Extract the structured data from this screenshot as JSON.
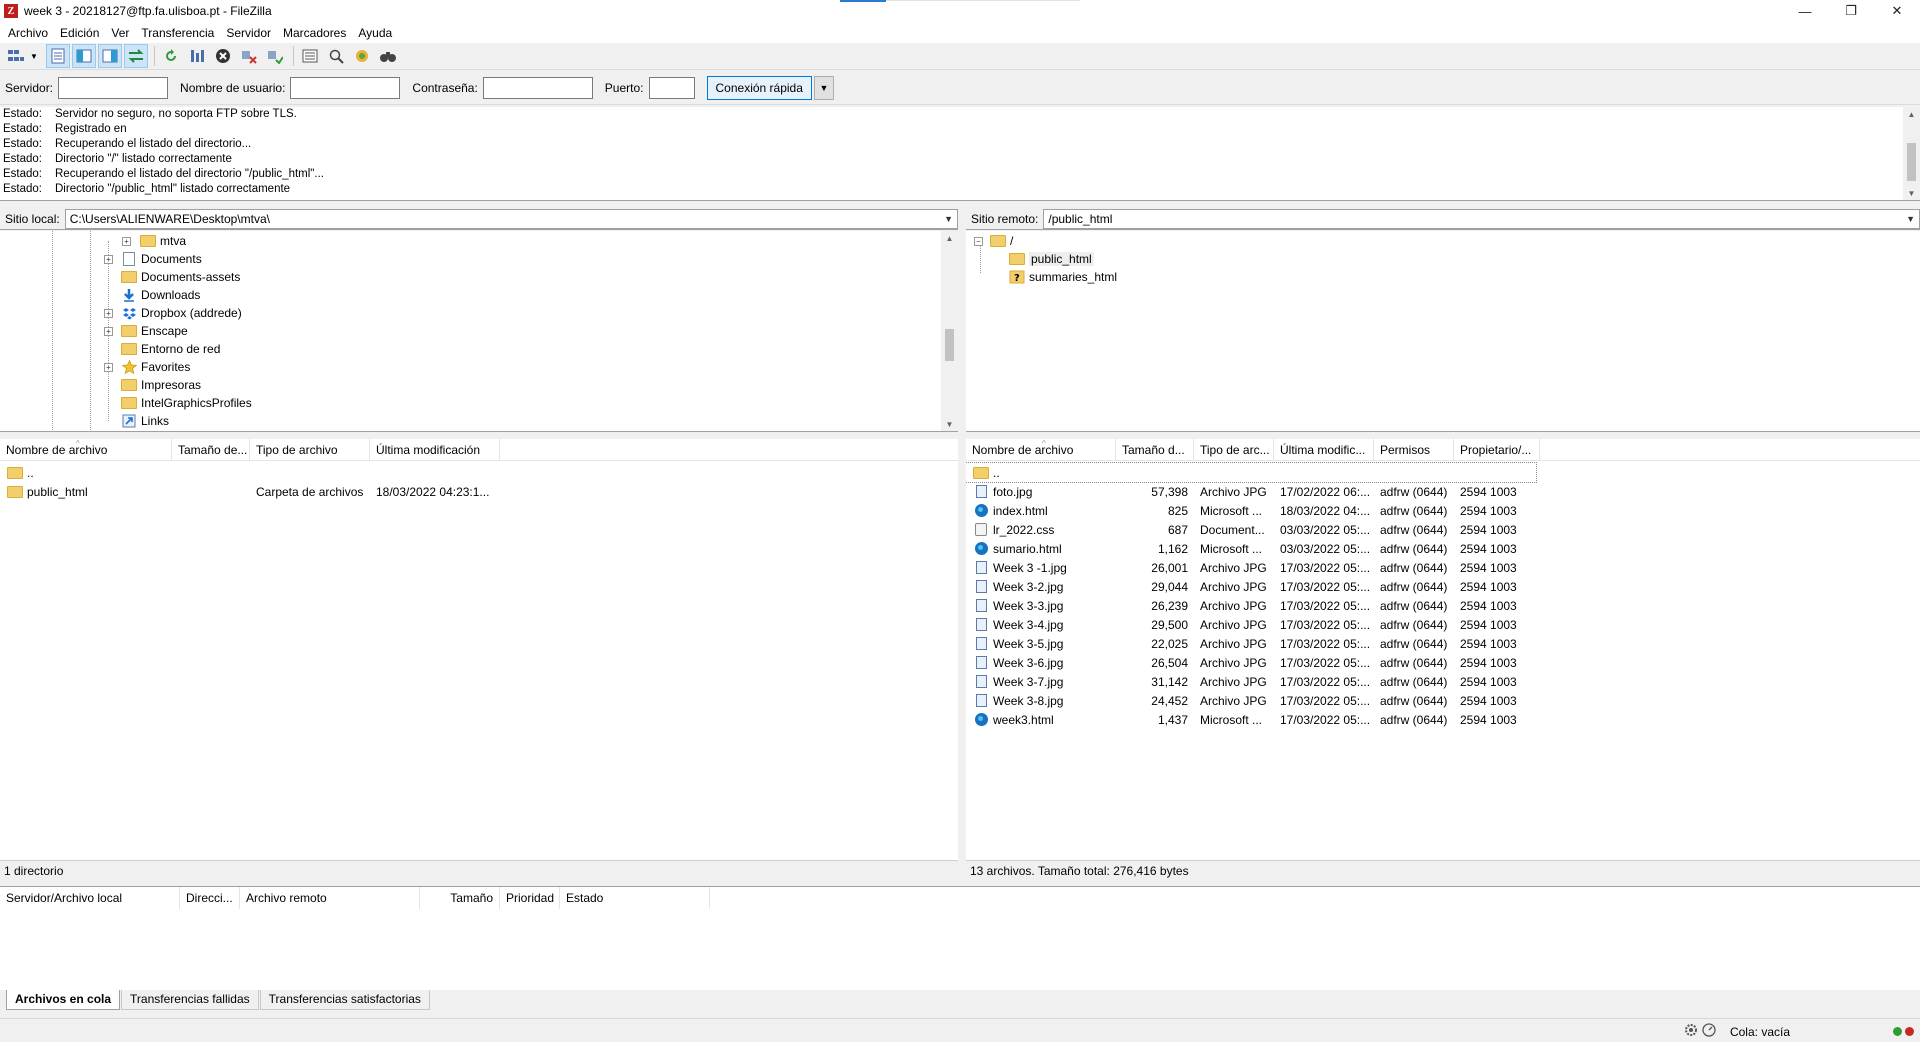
{
  "window": {
    "title": "week 3 - 20218127@ftp.fa.ulisboa.pt - FileZilla",
    "app_icon_letter": "Z",
    "minimize": "—",
    "maximize": "❐",
    "close": "✕"
  },
  "menu": [
    "Archivo",
    "Edición",
    "Ver",
    "Transferencia",
    "Servidor",
    "Marcadores",
    "Ayuda"
  ],
  "quickconnect": {
    "server_label": "Servidor:",
    "user_label": "Nombre de usuario:",
    "password_label": "Contraseña:",
    "port_label": "Puerto:",
    "server_value": "",
    "user_value": "",
    "password_value": "",
    "port_value": "",
    "connect_label": "Conexión rápida"
  },
  "log": [
    {
      "label": "Estado:",
      "text": "Servidor no seguro, no soporta FTP sobre TLS."
    },
    {
      "label": "Estado:",
      "text": "Registrado en"
    },
    {
      "label": "Estado:",
      "text": "Recuperando el listado del directorio..."
    },
    {
      "label": "Estado:",
      "text": "Directorio \"/\" listado correctamente"
    },
    {
      "label": "Estado:",
      "text": "Recuperando el listado del directorio \"/public_html\"..."
    },
    {
      "label": "Estado:",
      "text": "Directorio \"/public_html\" listado correctamente"
    }
  ],
  "local": {
    "site_label": "Sitio local:",
    "site_path": "C:\\Users\\ALIENWARE\\Desktop\\mtva\\",
    "tree": [
      {
        "name": "mtva",
        "icon": "folder-icon",
        "expander": "+"
      },
      {
        "name": "Documents",
        "icon": "documents-icon",
        "expander": "+"
      },
      {
        "name": "Documents-assets",
        "icon": "folder-icon",
        "expander": ""
      },
      {
        "name": "Downloads",
        "icon": "download-arrow-icon",
        "expander": ""
      },
      {
        "name": "Dropbox (addrede)",
        "icon": "dropbox-icon",
        "expander": "+"
      },
      {
        "name": "Enscape",
        "icon": "folder-icon",
        "expander": "+"
      },
      {
        "name": "Entorno de red",
        "icon": "folder-icon",
        "expander": ""
      },
      {
        "name": "Favorites",
        "icon": "star-icon",
        "expander": "+"
      },
      {
        "name": "Impresoras",
        "icon": "folder-icon",
        "expander": ""
      },
      {
        "name": "IntelGraphicsProfiles",
        "icon": "folder-icon",
        "expander": ""
      },
      {
        "name": "Links",
        "icon": "link-icon",
        "expander": ""
      }
    ],
    "columns": [
      "Nombre de archivo",
      "Tamaño de...",
      "Tipo de archivo",
      "Última modificación"
    ],
    "files": [
      {
        "name": "..",
        "size": "",
        "type": "",
        "modified": ""
      },
      {
        "name": "public_html",
        "size": "",
        "type": "Carpeta de archivos",
        "modified": "18/03/2022 04:23:1..."
      }
    ],
    "status": "1 directorio"
  },
  "remote": {
    "site_label": "Sitio remoto:",
    "site_path": "/public_html",
    "tree": [
      {
        "name": "/",
        "icon": "folder-icon",
        "expander": "−"
      },
      {
        "name": "public_html",
        "icon": "folder-icon",
        "expander": ""
      },
      {
        "name": "summaries_html",
        "icon": "unknown-folder-icon",
        "expander": ""
      }
    ],
    "columns": [
      "Nombre de archivo",
      "Tamaño d...",
      "Tipo de arc...",
      "Última modific...",
      "Permisos",
      "Propietario/..."
    ],
    "files": [
      {
        "name": "..",
        "size": "",
        "type": "",
        "modified": "",
        "perms": "",
        "owner": "",
        "icon": "folder-icon"
      },
      {
        "name": "foto.jpg",
        "size": "57,398",
        "type": "Archivo JPG",
        "modified": "17/02/2022 06:...",
        "perms": "adfrw (0644)",
        "owner": "2594 1003",
        "icon": "image-file-icon"
      },
      {
        "name": "index.html",
        "size": "825",
        "type": "Microsoft ...",
        "modified": "18/03/2022 04:...",
        "perms": "adfrw (0644)",
        "owner": "2594 1003",
        "icon": "edge-html-icon"
      },
      {
        "name": "lr_2022.css",
        "size": "687",
        "type": "Document...",
        "modified": "03/03/2022 05:...",
        "perms": "adfrw (0644)",
        "owner": "2594 1003",
        "icon": "css-file-icon"
      },
      {
        "name": "sumario.html",
        "size": "1,162",
        "type": "Microsoft ...",
        "modified": "03/03/2022 05:...",
        "perms": "adfrw (0644)",
        "owner": "2594 1003",
        "icon": "edge-html-icon"
      },
      {
        "name": "Week 3 -1.jpg",
        "size": "26,001",
        "type": "Archivo JPG",
        "modified": "17/03/2022 05:...",
        "perms": "adfrw (0644)",
        "owner": "2594 1003",
        "icon": "image-file-icon"
      },
      {
        "name": "Week 3-2.jpg",
        "size": "29,044",
        "type": "Archivo JPG",
        "modified": "17/03/2022 05:...",
        "perms": "adfrw (0644)",
        "owner": "2594 1003",
        "icon": "image-file-icon"
      },
      {
        "name": "Week 3-3.jpg",
        "size": "26,239",
        "type": "Archivo JPG",
        "modified": "17/03/2022 05:...",
        "perms": "adfrw (0644)",
        "owner": "2594 1003",
        "icon": "image-file-icon"
      },
      {
        "name": "Week 3-4.jpg",
        "size": "29,500",
        "type": "Archivo JPG",
        "modified": "17/03/2022 05:...",
        "perms": "adfrw (0644)",
        "owner": "2594 1003",
        "icon": "image-file-icon"
      },
      {
        "name": "Week 3-5.jpg",
        "size": "22,025",
        "type": "Archivo JPG",
        "modified": "17/03/2022 05:...",
        "perms": "adfrw (0644)",
        "owner": "2594 1003",
        "icon": "image-file-icon"
      },
      {
        "name": "Week 3-6.jpg",
        "size": "26,504",
        "type": "Archivo JPG",
        "modified": "17/03/2022 05:...",
        "perms": "adfrw (0644)",
        "owner": "2594 1003",
        "icon": "image-file-icon"
      },
      {
        "name": "Week 3-7.jpg",
        "size": "31,142",
        "type": "Archivo JPG",
        "modified": "17/03/2022 05:...",
        "perms": "adfrw (0644)",
        "owner": "2594 1003",
        "icon": "image-file-icon"
      },
      {
        "name": "Week 3-8.jpg",
        "size": "24,452",
        "type": "Archivo JPG",
        "modified": "17/03/2022 05:...",
        "perms": "adfrw (0644)",
        "owner": "2594 1003",
        "icon": "image-file-icon"
      },
      {
        "name": "week3.html",
        "size": "1,437",
        "type": "Microsoft ...",
        "modified": "17/03/2022 05:...",
        "perms": "adfrw (0644)",
        "owner": "2594 1003",
        "icon": "edge-html-icon"
      }
    ],
    "status": "13 archivos. Tamaño total: 276,416 bytes"
  },
  "queue": {
    "columns": [
      "Servidor/Archivo local",
      "Direcci...",
      "Archivo remoto",
      "Tamaño",
      "Prioridad",
      "Estado"
    ],
    "tabs": [
      "Archivos en cola",
      "Transferencias fallidas",
      "Transferencias satisfactorias"
    ],
    "status": "Cola: vacía"
  },
  "colors": {
    "accent": "#0078d7",
    "folder": "#f3cf6b",
    "led_green": "#2f9e2f",
    "led_red": "#c62828"
  }
}
